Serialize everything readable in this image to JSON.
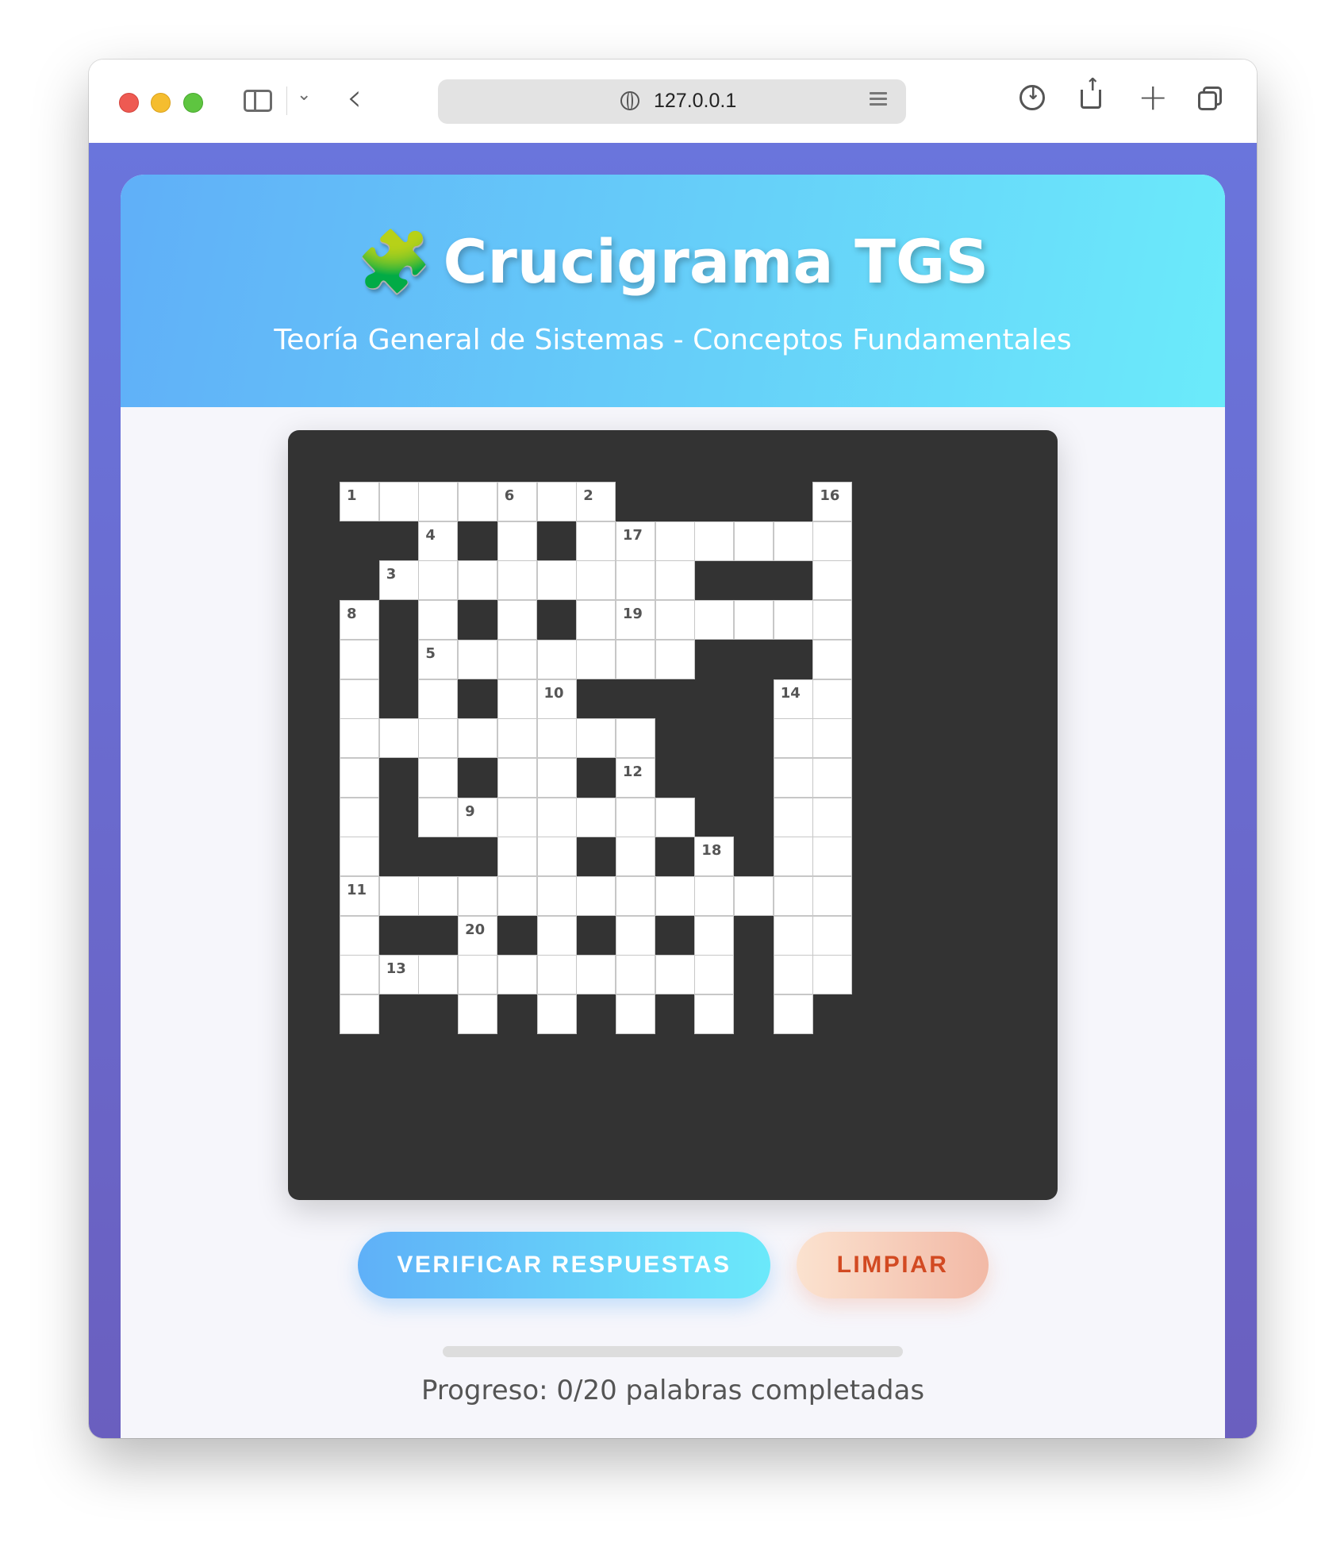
{
  "browser": {
    "url": "127.0.0.1"
  },
  "header": {
    "icon": "puzzle-icon",
    "title": "Crucigrama TGS",
    "subtitle": "Teoría General de Sistemas - Conceptos Fundamentales"
  },
  "crossword": {
    "rows": 14,
    "cols": 14,
    "cells": [
      [
        0,
        1,
        "1"
      ],
      [
        0,
        2,
        ""
      ],
      [
        0,
        3,
        ""
      ],
      [
        0,
        4,
        ""
      ],
      [
        0,
        5,
        "6"
      ],
      [
        0,
        6,
        ""
      ],
      [
        0,
        7,
        "2"
      ],
      [
        0,
        13,
        "16"
      ],
      [
        1,
        3,
        "4"
      ],
      [
        1,
        5,
        ""
      ],
      [
        1,
        7,
        ""
      ],
      [
        1,
        8,
        "17"
      ],
      [
        1,
        9,
        ""
      ],
      [
        1,
        10,
        ""
      ],
      [
        1,
        11,
        ""
      ],
      [
        1,
        12,
        ""
      ],
      [
        1,
        13,
        ""
      ],
      [
        2,
        2,
        "3"
      ],
      [
        2,
        3,
        ""
      ],
      [
        2,
        4,
        ""
      ],
      [
        2,
        5,
        ""
      ],
      [
        2,
        6,
        ""
      ],
      [
        2,
        7,
        ""
      ],
      [
        2,
        8,
        ""
      ],
      [
        2,
        9,
        ""
      ],
      [
        2,
        13,
        ""
      ],
      [
        3,
        1,
        "8"
      ],
      [
        3,
        3,
        ""
      ],
      [
        3,
        5,
        ""
      ],
      [
        3,
        7,
        ""
      ],
      [
        3,
        8,
        "19"
      ],
      [
        3,
        9,
        ""
      ],
      [
        3,
        10,
        ""
      ],
      [
        3,
        11,
        ""
      ],
      [
        3,
        12,
        ""
      ],
      [
        3,
        13,
        ""
      ],
      [
        4,
        1,
        ""
      ],
      [
        4,
        3,
        "5"
      ],
      [
        4,
        4,
        ""
      ],
      [
        4,
        5,
        ""
      ],
      [
        4,
        6,
        ""
      ],
      [
        4,
        7,
        ""
      ],
      [
        4,
        8,
        ""
      ],
      [
        4,
        9,
        ""
      ],
      [
        4,
        13,
        ""
      ],
      [
        5,
        1,
        ""
      ],
      [
        5,
        3,
        ""
      ],
      [
        5,
        5,
        ""
      ],
      [
        5,
        6,
        "10"
      ],
      [
        5,
        12,
        "14"
      ],
      [
        5,
        13,
        ""
      ],
      [
        6,
        1,
        ""
      ],
      [
        6,
        2,
        ""
      ],
      [
        6,
        3,
        ""
      ],
      [
        6,
        4,
        ""
      ],
      [
        6,
        5,
        ""
      ],
      [
        6,
        6,
        ""
      ],
      [
        6,
        7,
        ""
      ],
      [
        6,
        8,
        ""
      ],
      [
        6,
        12,
        ""
      ],
      [
        6,
        13,
        ""
      ],
      [
        7,
        1,
        ""
      ],
      [
        7,
        3,
        ""
      ],
      [
        7,
        5,
        ""
      ],
      [
        7,
        6,
        ""
      ],
      [
        7,
        8,
        "12"
      ],
      [
        7,
        12,
        ""
      ],
      [
        7,
        13,
        ""
      ],
      [
        8,
        1,
        ""
      ],
      [
        8,
        3,
        ""
      ],
      [
        8,
        4,
        "9"
      ],
      [
        8,
        5,
        ""
      ],
      [
        8,
        6,
        ""
      ],
      [
        8,
        7,
        ""
      ],
      [
        8,
        8,
        ""
      ],
      [
        8,
        9,
        ""
      ],
      [
        8,
        12,
        ""
      ],
      [
        8,
        13,
        ""
      ],
      [
        9,
        1,
        ""
      ],
      [
        9,
        5,
        ""
      ],
      [
        9,
        6,
        ""
      ],
      [
        9,
        8,
        ""
      ],
      [
        9,
        10,
        "18"
      ],
      [
        9,
        12,
        ""
      ],
      [
        9,
        13,
        ""
      ],
      [
        10,
        1,
        "11"
      ],
      [
        10,
        2,
        ""
      ],
      [
        10,
        3,
        ""
      ],
      [
        10,
        4,
        ""
      ],
      [
        10,
        5,
        ""
      ],
      [
        10,
        6,
        ""
      ],
      [
        10,
        7,
        ""
      ],
      [
        10,
        8,
        ""
      ],
      [
        10,
        9,
        ""
      ],
      [
        10,
        10,
        ""
      ],
      [
        10,
        11,
        ""
      ],
      [
        10,
        12,
        ""
      ],
      [
        10,
        13,
        ""
      ],
      [
        11,
        1,
        ""
      ],
      [
        11,
        4,
        "20"
      ],
      [
        11,
        6,
        ""
      ],
      [
        11,
        8,
        ""
      ],
      [
        11,
        10,
        ""
      ],
      [
        11,
        12,
        ""
      ],
      [
        11,
        13,
        ""
      ],
      [
        12,
        1,
        ""
      ],
      [
        12,
        2,
        "13"
      ],
      [
        12,
        3,
        ""
      ],
      [
        12,
        4,
        ""
      ],
      [
        12,
        5,
        ""
      ],
      [
        12,
        6,
        ""
      ],
      [
        12,
        7,
        ""
      ],
      [
        12,
        8,
        ""
      ],
      [
        12,
        9,
        ""
      ],
      [
        12,
        10,
        ""
      ],
      [
        12,
        12,
        ""
      ],
      [
        12,
        13,
        ""
      ],
      [
        13,
        1,
        ""
      ],
      [
        13,
        4,
        ""
      ],
      [
        13,
        6,
        ""
      ],
      [
        13,
        8,
        ""
      ],
      [
        13,
        10,
        ""
      ],
      [
        13,
        12,
        ""
      ]
    ]
  },
  "actions": {
    "verify_label": "VERIFICAR RESPUESTAS",
    "clear_label": "LIMPIAR"
  },
  "progress": {
    "fraction": 0,
    "text": "Progreso: 0/20 palabras completadas"
  }
}
